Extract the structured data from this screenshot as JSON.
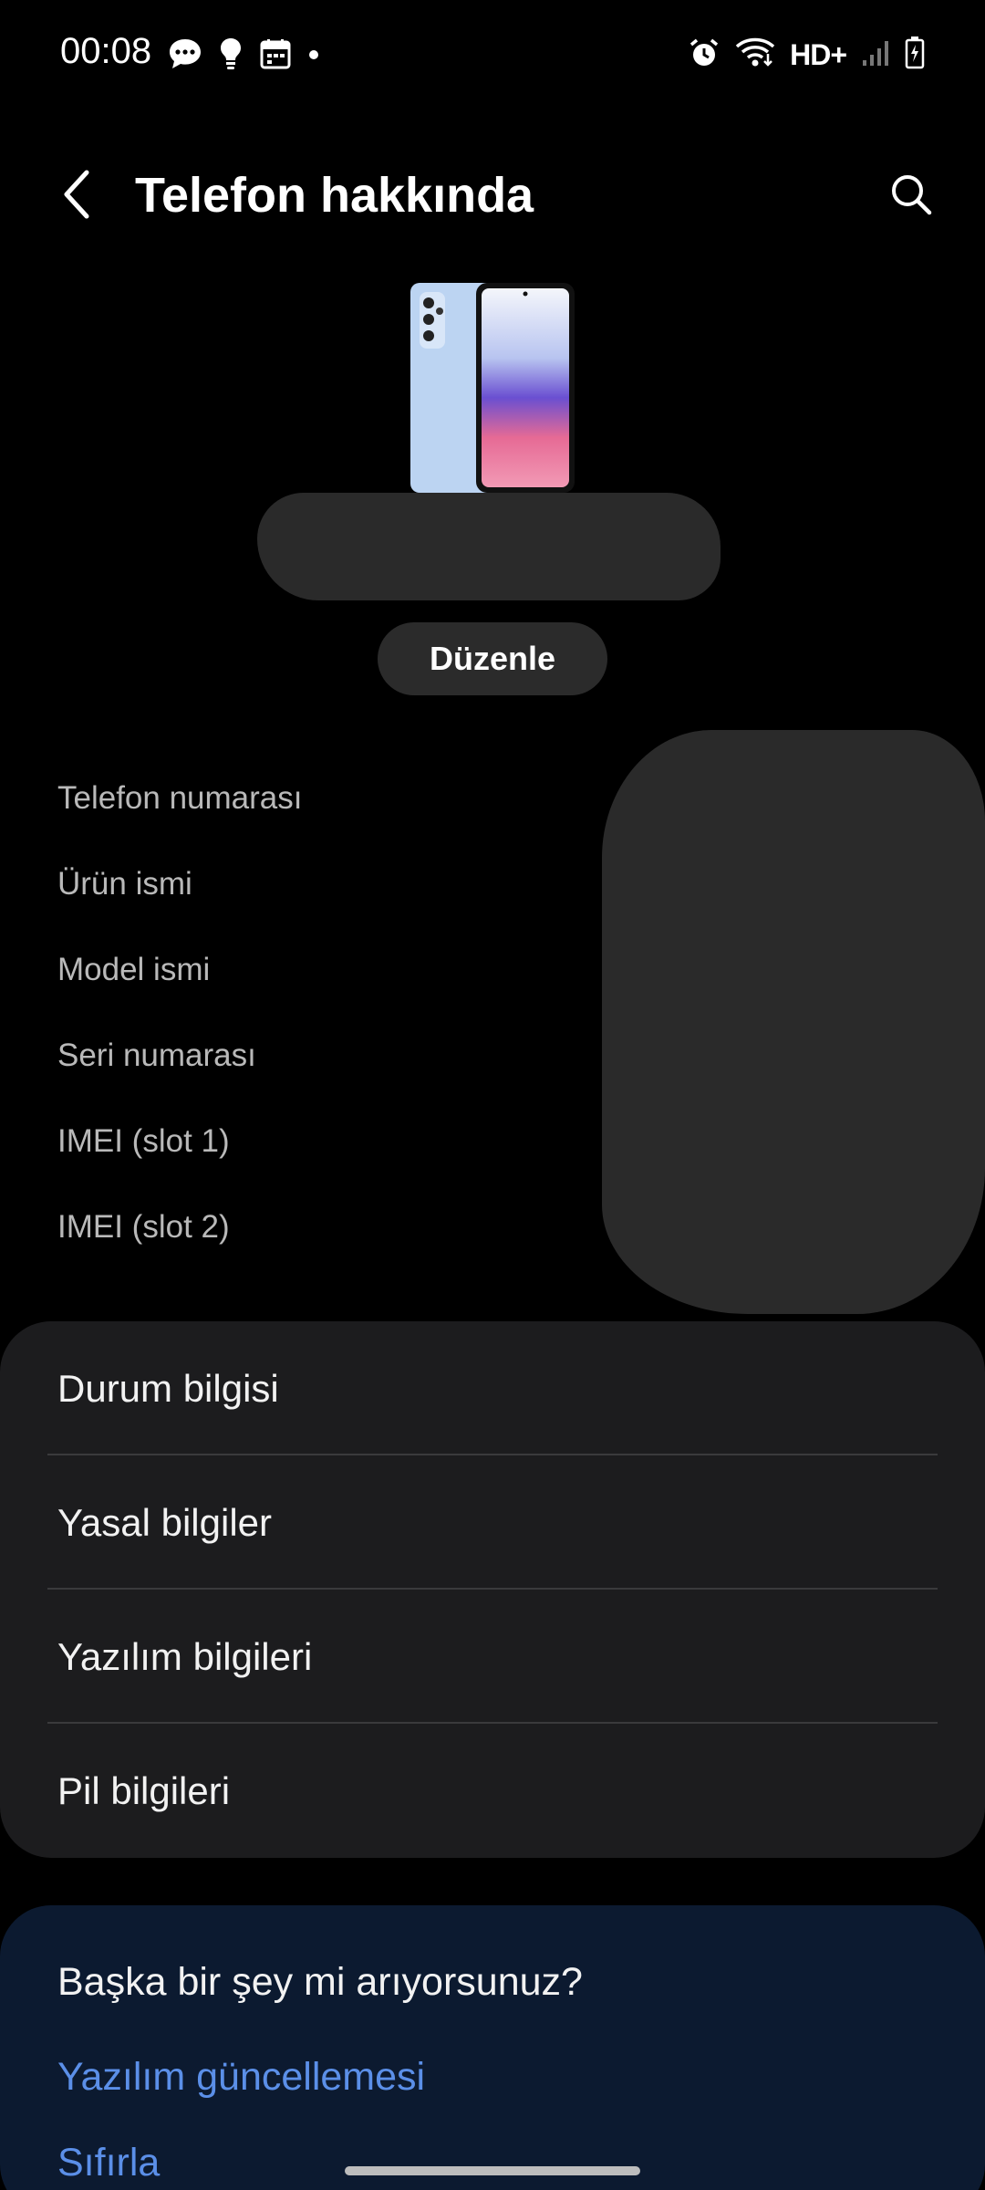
{
  "status_bar": {
    "time": "00:08",
    "network_label": "HD+",
    "icons": [
      "chat-bubble-icon",
      "lightbulb-icon",
      "calendar-icon",
      "dot-icon",
      "alarm-icon",
      "wifi-icon",
      "signal-icon",
      "battery-icon"
    ]
  },
  "header": {
    "title": "Telefon hakkında"
  },
  "device": {
    "edit_label": "Düzenle"
  },
  "info": {
    "rows": [
      "Telefon numarası",
      "Ürün ismi",
      "Model ismi",
      "Seri numarası",
      "IMEI (slot 1)",
      "IMEI (slot 2)"
    ]
  },
  "menu": {
    "items": [
      "Durum bilgisi",
      "Yasal bilgiler",
      "Yazılım bilgileri",
      "Pil bilgileri"
    ]
  },
  "suggestions": {
    "title": "Başka bir şey mi arıyorsunuz?",
    "links": [
      "Yazılım güncellemesi",
      "Sıfırla"
    ]
  },
  "colors": {
    "background": "#000000",
    "card": "#1c1c1e",
    "suggest_card": "#0c1a30",
    "link": "#5b8fe8",
    "secondary_text": "#b9b9b9"
  }
}
